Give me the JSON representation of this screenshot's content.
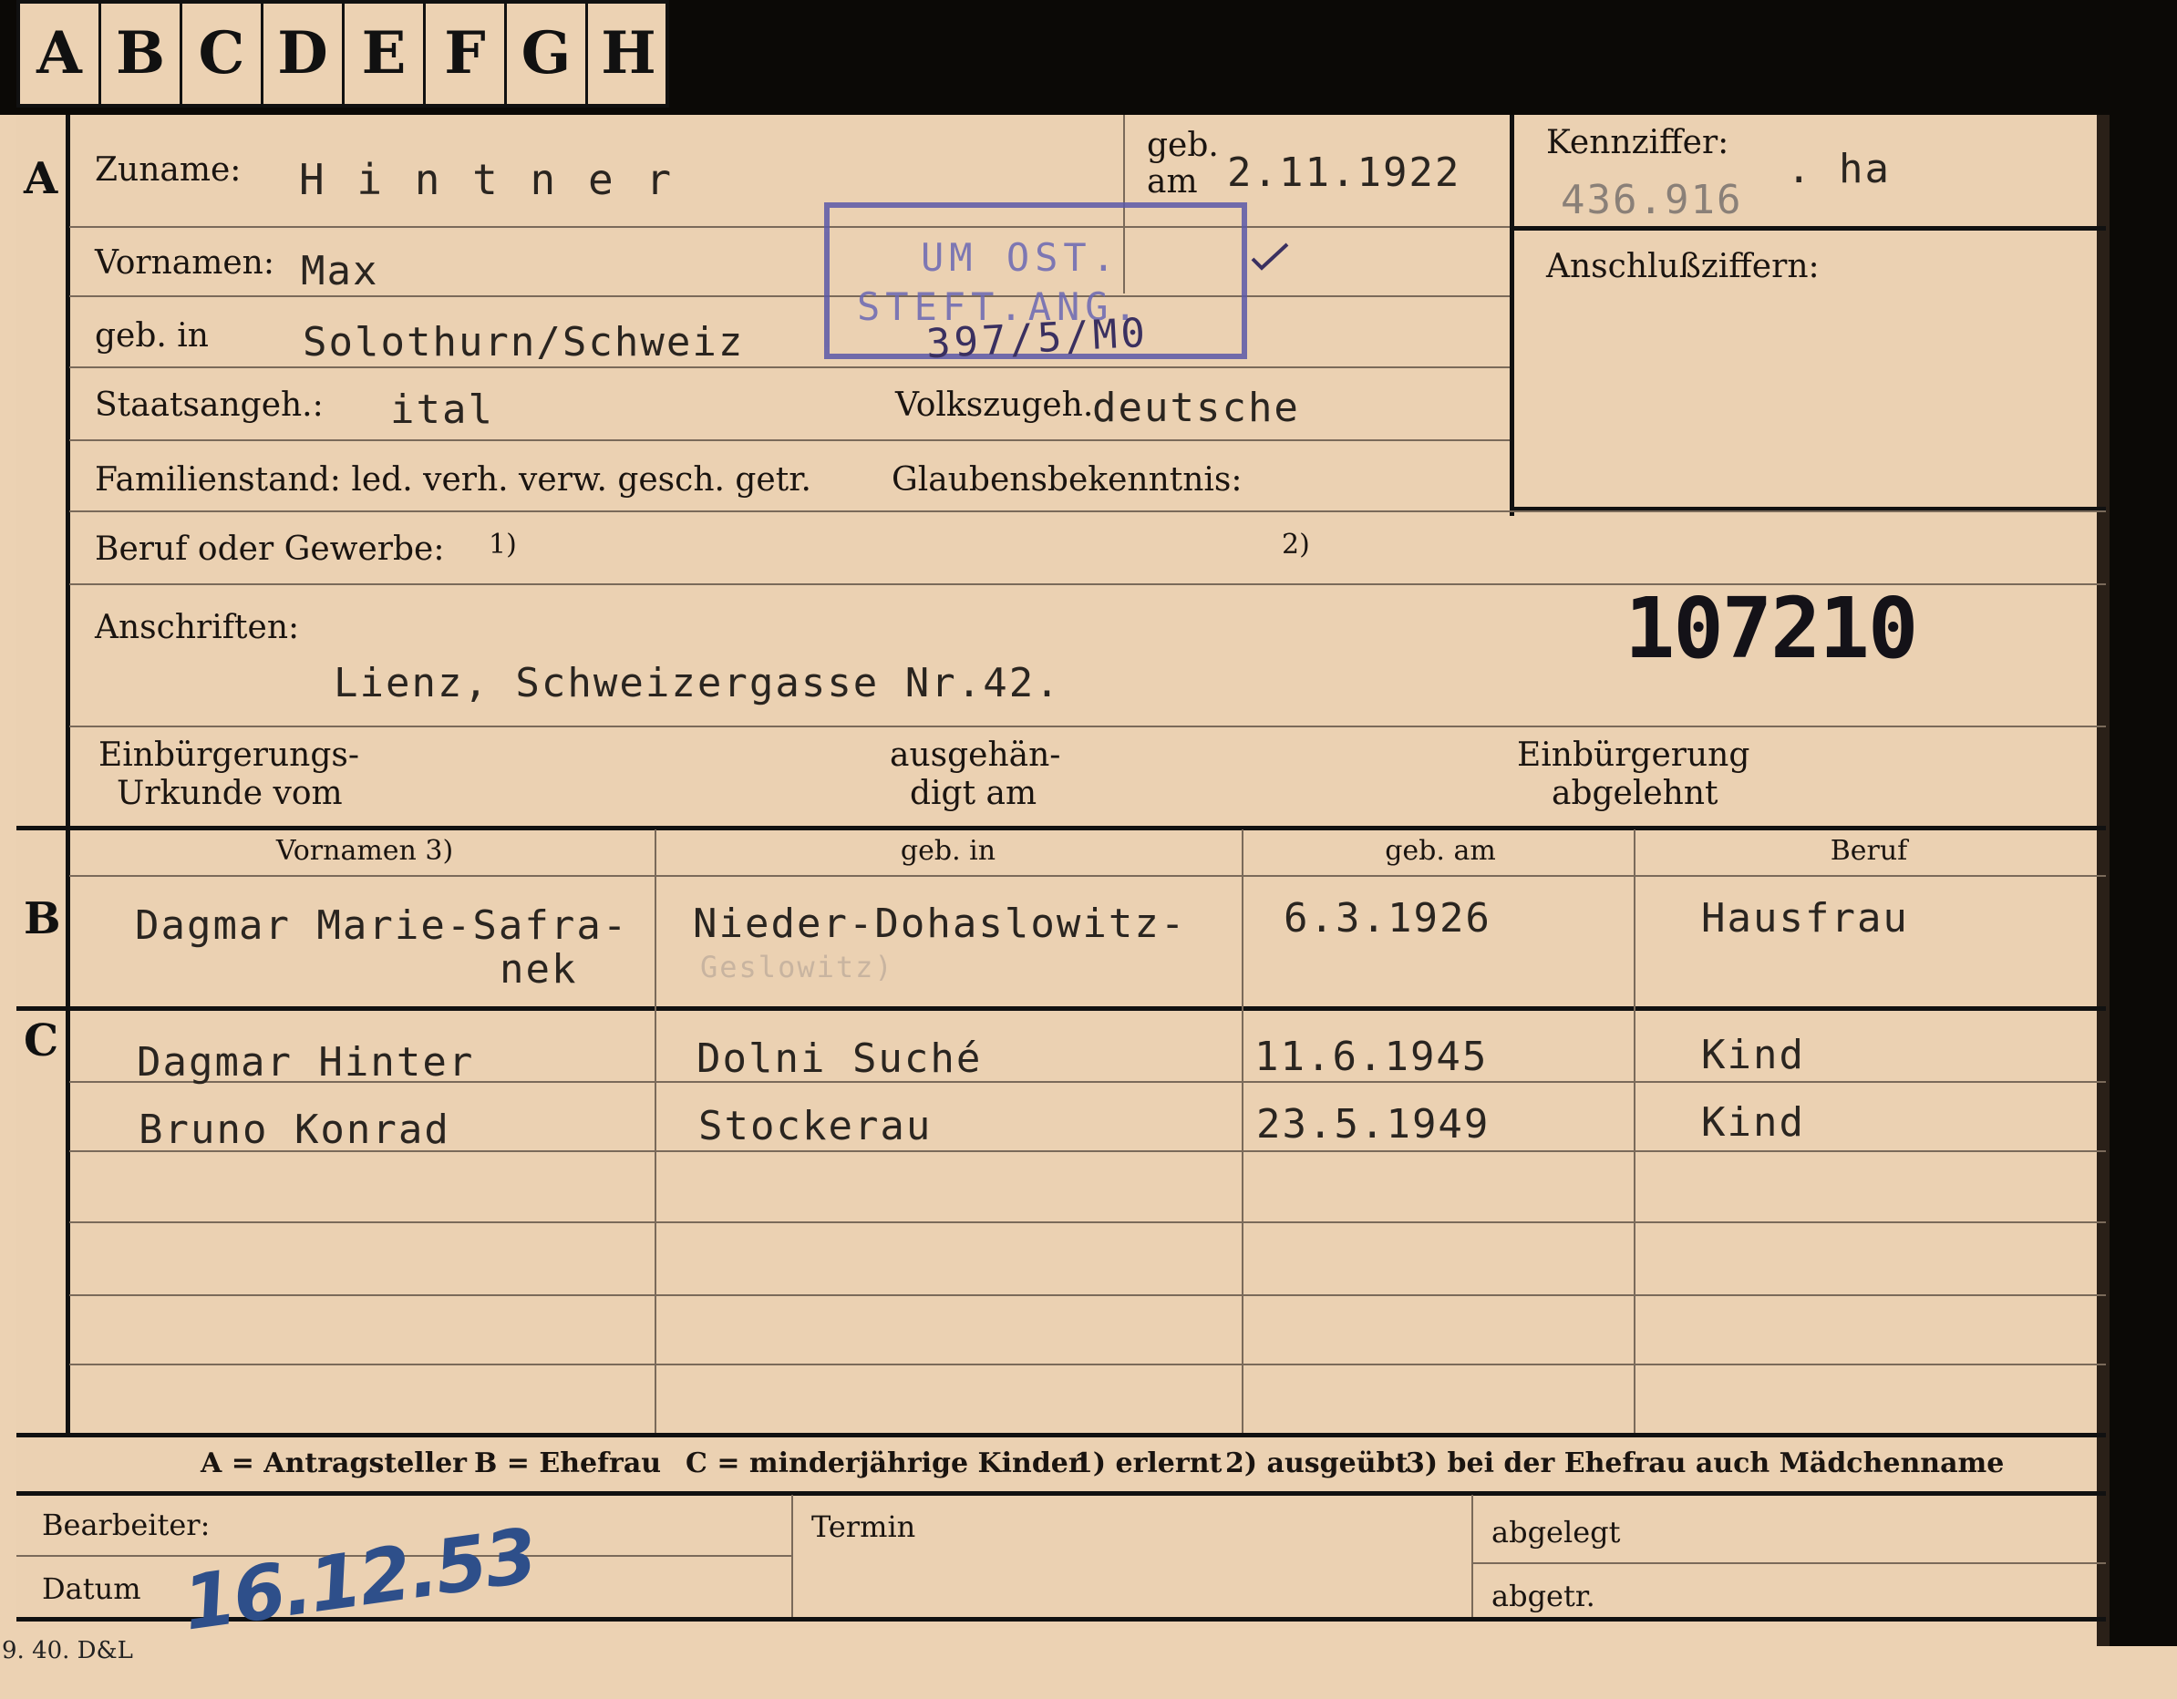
{
  "tabs": [
    "A",
    "B",
    "C",
    "D",
    "E",
    "F",
    "G",
    "H"
  ],
  "sections": {
    "a": "A",
    "b": "B",
    "c": "C"
  },
  "labels": {
    "zuname": "Zuname:",
    "geb_am": "geb.\nam",
    "kennziffer": "Kennziffer:",
    "vornamen": "Vornamen:",
    "anschlussziffern": "Anschlußziffern:",
    "geb_in": "geb. in",
    "staatsangeh": "Staatsangeh.:",
    "volkszugeh": "Volkszugeh.",
    "familienstand": "Familienstand: led. verh. verw. gesch. getr.",
    "glaubensbekenntnis": "Glaubensbekenntnis:",
    "beruf": "Beruf oder Gewerbe:",
    "note1": "1)",
    "note2": "2)",
    "anschriften": "Anschriften:",
    "einb_urkunde_1": "Einbürgerungs-",
    "einb_urkunde_2": "Urkunde vom",
    "ausgehaendigt_1": "ausgehän-",
    "ausgehaendigt_2": "digt am",
    "abgelehnt_1": "Einbürgerung",
    "abgelehnt_2": "abgelehnt"
  },
  "applicant": {
    "surname": "H i n t n e r",
    "birth_date": "2.11.1922",
    "kennziffer": "436.916",
    "kennziffer_suffix": ". ha",
    "first_name": "Max",
    "birthplace": "Solothurn/Schweiz",
    "citizenship": "ital",
    "ethnicity": "deutsche",
    "address": "Lienz, Schweizergasse Nr.42.",
    "file_number": "107210"
  },
  "stamp": {
    "line1": "UM OST.",
    "line2": "STEFT.ANG.",
    "handwritten": "397/5/M0"
  },
  "table_headers": {
    "vornamen": "Vornamen 3)",
    "geb_in": "geb. in",
    "geb_am": "geb. am",
    "beruf": "Beruf"
  },
  "spouse": {
    "name_line1": "Dagmar Marie-Safra-",
    "name_line2": "nek",
    "birthplace_line1": "Nieder-Dohaslowitz-",
    "birthplace_line2": "Geslowitz)",
    "birth_date": "6.3.1926",
    "occupation": "Hausfrau"
  },
  "children": [
    {
      "name": "Dagmar Hinter",
      "birthplace": "Dolni Suché",
      "birth_date": "11.6.1945",
      "occupation": "Kind"
    },
    {
      "name": "Bruno Konrad",
      "birthplace": "Stockerau",
      "birth_date": "23.5.1949",
      "occupation": "Kind"
    }
  ],
  "legend": {
    "a": "A = Antragsteller",
    "b": "B = Ehefrau",
    "c": "C = minderjährige Kinder",
    "n1": "1) erlernt",
    "n2": "2) ausgeübt",
    "n3": "3) bei der Ehefrau auch Mädchenname"
  },
  "bottom": {
    "bearbeiter": "Bearbeiter:",
    "datum": "Datum",
    "date_value": "16.12.53",
    "termin": "Termin",
    "abgelegt": "abgelegt",
    "abgetr": "abgetr."
  },
  "form_code": "9. 40. D&L"
}
